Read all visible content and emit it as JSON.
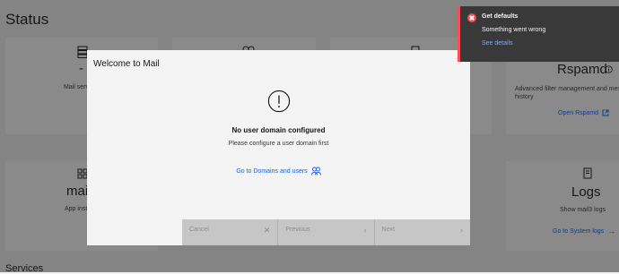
{
  "page": {
    "title": "Status",
    "services_heading": "Services"
  },
  "cards": {
    "mail_server": {
      "value": "-",
      "label": "Mail server h"
    },
    "rspamd": {
      "title": "Rspamd",
      "description": "Advanced filter management and mes history",
      "link": "Open Rspamd"
    },
    "app": {
      "name": "mai",
      "label": "App inst"
    },
    "logs": {
      "title": "Logs",
      "description": "Show mail3 logs",
      "link": "Go to System logs"
    }
  },
  "modal": {
    "title": "Welcome to Mail",
    "empty_title": "No user domain configured",
    "empty_description": "Please configure a user domain first",
    "link": "Go to Domains and users",
    "buttons": {
      "cancel": "Cancel",
      "previous": "Previous",
      "next": "Next"
    }
  },
  "toast": {
    "title": "Get defaults",
    "subtitle": "Something went wrong",
    "link": "See details",
    "accent": "#fa4d56"
  }
}
